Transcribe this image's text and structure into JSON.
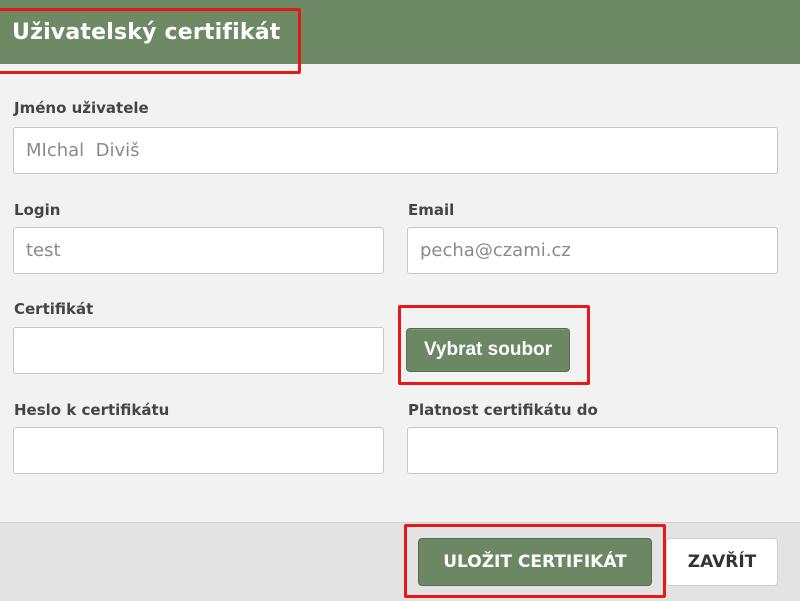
{
  "dialog": {
    "title": "Uživatelský certifikát"
  },
  "form": {
    "user_name": {
      "label": "Jméno uživatele",
      "value": "MIchal  Diviš"
    },
    "login": {
      "label": "Login",
      "value": "test"
    },
    "email": {
      "label": "Email",
      "value": "pecha@czami.cz"
    },
    "certificate": {
      "label": "Certifikát",
      "value": "",
      "browse_label": "Vybrat soubor"
    },
    "certificate_password": {
      "label": "Heslo k certifikátu",
      "value": ""
    },
    "certificate_valid_until": {
      "label": "Platnost certifikátu do",
      "value": ""
    }
  },
  "footer": {
    "save_label": "ULOŽIT CERTIFIKÁT",
    "close_label": "ZAVŘÍT"
  },
  "colors": {
    "header": "#6d8a64",
    "primary_button": "#6b8763",
    "highlight": "#e81818"
  }
}
